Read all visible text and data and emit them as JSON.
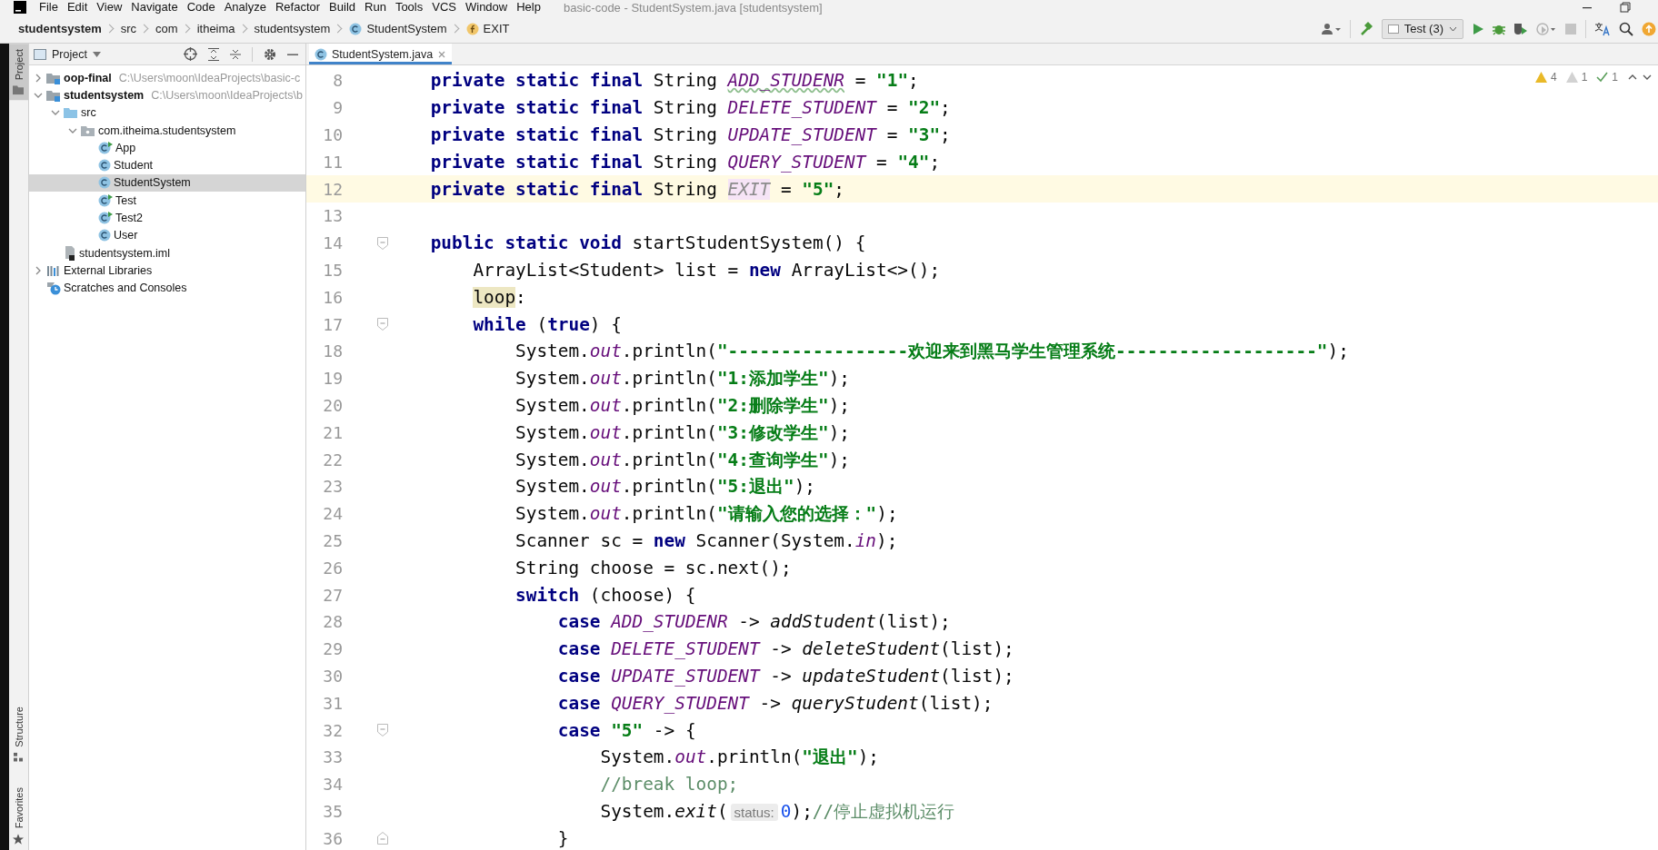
{
  "window": {
    "title": "basic-code - StudentSystem.java [studentsystem]",
    "menu": [
      "File",
      "Edit",
      "View",
      "Navigate",
      "Code",
      "Analyze",
      "Refactor",
      "Build",
      "Run",
      "Tools",
      "VCS",
      "Window",
      "Help"
    ]
  },
  "breadcrumb": [
    {
      "label": "studentsystem",
      "kind": "project"
    },
    {
      "label": "src",
      "kind": "plain"
    },
    {
      "label": "com",
      "kind": "plain"
    },
    {
      "label": "itheima",
      "kind": "plain"
    },
    {
      "label": "studentsystem",
      "kind": "plain"
    },
    {
      "label": "StudentSystem",
      "kind": "class"
    },
    {
      "label": "EXIT",
      "kind": "field"
    }
  ],
  "toolbar": {
    "run_config": "Test (3)"
  },
  "side_tabs": [
    {
      "label": "Project",
      "kind": "project",
      "selected": true
    },
    {
      "label": "Structure",
      "kind": "structure",
      "selected": false
    },
    {
      "label": "Favorites",
      "kind": "favorites",
      "selected": false
    }
  ],
  "project": {
    "title": "Project",
    "tree": [
      {
        "label": "oop-final",
        "kind": "module",
        "path": "C:\\Users\\moon\\IdeaProjects\\basic-c",
        "expanded": false,
        "selected": false
      },
      {
        "label": "studentsystem",
        "kind": "module",
        "path": "C:\\Users\\moon\\IdeaProjects\\b",
        "expanded": true,
        "selected": false,
        "children": [
          {
            "label": "src",
            "kind": "source-folder",
            "expanded": true,
            "selected": false,
            "children": [
              {
                "label": "com.itheima.studentsystem",
                "kind": "package",
                "expanded": true,
                "selected": false,
                "children": [
                  {
                    "label": "App",
                    "kind": "runnable-class",
                    "selected": false
                  },
                  {
                    "label": "Student",
                    "kind": "class",
                    "selected": false
                  },
                  {
                    "label": "StudentSystem",
                    "kind": "class",
                    "selected": true
                  },
                  {
                    "label": "Test",
                    "kind": "runnable-class",
                    "selected": false
                  },
                  {
                    "label": "Test2",
                    "kind": "runnable-class",
                    "selected": false
                  },
                  {
                    "label": "User",
                    "kind": "class",
                    "selected": false
                  }
                ]
              }
            ]
          },
          {
            "label": "studentsystem.iml",
            "kind": "module-file",
            "selected": false
          }
        ]
      },
      {
        "label": "External Libraries",
        "kind": "libraries",
        "expanded": false,
        "selected": false
      },
      {
        "label": "Scratches and Consoles",
        "kind": "scratches",
        "selected": false
      }
    ]
  },
  "editor": {
    "tab": {
      "label": "StudentSystem.java",
      "selected": true
    },
    "inspections": {
      "warnings": "4",
      "weak_warnings": "1",
      "typos": "1"
    },
    "lines": [
      {
        "number": "8",
        "current": false,
        "tokens": [
          {
            "kind": "kw",
            "text": "    private static final"
          },
          {
            "kind": "plain",
            "text": " String "
          },
          {
            "kind": "typo",
            "text": "ADD_STUDENR"
          },
          {
            "kind": "plain",
            "text": " = "
          },
          {
            "kind": "str",
            "text": "\"1\""
          },
          {
            "kind": "plain",
            "text": ";"
          }
        ]
      },
      {
        "number": "9",
        "current": false,
        "tokens": [
          {
            "kind": "kw",
            "text": "    private static final"
          },
          {
            "kind": "plain",
            "text": " String "
          },
          {
            "kind": "const",
            "text": "DELETE_STUDENT"
          },
          {
            "kind": "plain",
            "text": " = "
          },
          {
            "kind": "str",
            "text": "\"2\""
          },
          {
            "kind": "plain",
            "text": ";"
          }
        ]
      },
      {
        "number": "10",
        "current": false,
        "tokens": [
          {
            "kind": "kw",
            "text": "    private static final"
          },
          {
            "kind": "plain",
            "text": " String "
          },
          {
            "kind": "const",
            "text": "UPDATE_STUDENT"
          },
          {
            "kind": "plain",
            "text": " = "
          },
          {
            "kind": "str",
            "text": "\"3\""
          },
          {
            "kind": "plain",
            "text": ";"
          }
        ]
      },
      {
        "number": "11",
        "current": false,
        "tokens": [
          {
            "kind": "kw",
            "text": "    private static final"
          },
          {
            "kind": "plain",
            "text": " String "
          },
          {
            "kind": "const",
            "text": "QUERY_STUDENT"
          },
          {
            "kind": "plain",
            "text": " = "
          },
          {
            "kind": "str",
            "text": "\"4\""
          },
          {
            "kind": "plain",
            "text": ";"
          }
        ]
      },
      {
        "number": "12",
        "current": true,
        "tokens": [
          {
            "kind": "kw",
            "text": "    private static final"
          },
          {
            "kind": "plain",
            "text": " String "
          },
          {
            "kind": "unused",
            "text": "EXIT"
          },
          {
            "kind": "plain",
            "text": " = "
          },
          {
            "kind": "str",
            "text": "\"5\""
          },
          {
            "kind": "plain",
            "text": ";"
          }
        ]
      },
      {
        "number": "13",
        "current": false
      },
      {
        "number": "14",
        "current": false,
        "fold": {
          "kind": "start"
        },
        "tokens": [
          {
            "kind": "kw",
            "text": "    public static void"
          },
          {
            "kind": "plain",
            "text": " startStudentSystem() {"
          }
        ]
      },
      {
        "number": "15",
        "current": false,
        "tokens": [
          {
            "kind": "plain",
            "text": "        ArrayList<Student> list = "
          },
          {
            "kind": "kw",
            "text": "new"
          },
          {
            "kind": "plain",
            "text": " ArrayList<>();"
          }
        ]
      },
      {
        "number": "16",
        "current": false,
        "tokens": [
          {
            "kind": "label",
            "text": "        loop"
          },
          {
            "kind": "plain",
            "text": ":"
          }
        ]
      },
      {
        "number": "17",
        "current": false,
        "fold": {
          "kind": "start"
        },
        "tokens": [
          {
            "kind": "kw",
            "text": "        while"
          },
          {
            "kind": "plain",
            "text": " ("
          },
          {
            "kind": "kw",
            "text": "true"
          },
          {
            "kind": "plain",
            "text": ") {"
          }
        ]
      },
      {
        "number": "18",
        "current": false,
        "tokens": [
          {
            "kind": "plain",
            "text": "            System."
          },
          {
            "kind": "field",
            "text": "out"
          },
          {
            "kind": "plain",
            "text": ".println("
          },
          {
            "kind": "str",
            "text": "\"-----------------欢迎来到黑马学生管理系统-------------------\""
          },
          {
            "kind": "plain",
            "text": ");"
          }
        ]
      },
      {
        "number": "19",
        "current": false,
        "tokens": [
          {
            "kind": "plain",
            "text": "            System."
          },
          {
            "kind": "field",
            "text": "out"
          },
          {
            "kind": "plain",
            "text": ".println("
          },
          {
            "kind": "str",
            "text": "\"1:添加学生\""
          },
          {
            "kind": "plain",
            "text": ");"
          }
        ]
      },
      {
        "number": "20",
        "current": false,
        "tokens": [
          {
            "kind": "plain",
            "text": "            System."
          },
          {
            "kind": "field",
            "text": "out"
          },
          {
            "kind": "plain",
            "text": ".println("
          },
          {
            "kind": "str",
            "text": "\"2:删除学生\""
          },
          {
            "kind": "plain",
            "text": ");"
          }
        ]
      },
      {
        "number": "21",
        "current": false,
        "tokens": [
          {
            "kind": "plain",
            "text": "            System."
          },
          {
            "kind": "field",
            "text": "out"
          },
          {
            "kind": "plain",
            "text": ".println("
          },
          {
            "kind": "str",
            "text": "\"3:修改学生\""
          },
          {
            "kind": "plain",
            "text": ");"
          }
        ]
      },
      {
        "number": "22",
        "current": false,
        "tokens": [
          {
            "kind": "plain",
            "text": "            System."
          },
          {
            "kind": "field",
            "text": "out"
          },
          {
            "kind": "plain",
            "text": ".println("
          },
          {
            "kind": "str",
            "text": "\"4:查询学生\""
          },
          {
            "kind": "plain",
            "text": ");"
          }
        ]
      },
      {
        "number": "23",
        "current": false,
        "tokens": [
          {
            "kind": "plain",
            "text": "            System."
          },
          {
            "kind": "field",
            "text": "out"
          },
          {
            "kind": "plain",
            "text": ".println("
          },
          {
            "kind": "str",
            "text": "\"5:退出\""
          },
          {
            "kind": "plain",
            "text": ");"
          }
        ]
      },
      {
        "number": "24",
        "current": false,
        "tokens": [
          {
            "kind": "plain",
            "text": "            System."
          },
          {
            "kind": "field",
            "text": "out"
          },
          {
            "kind": "plain",
            "text": ".println("
          },
          {
            "kind": "str",
            "text": "\"请输入您的选择：\""
          },
          {
            "kind": "plain",
            "text": ");"
          }
        ]
      },
      {
        "number": "25",
        "current": false,
        "tokens": [
          {
            "kind": "plain",
            "text": "            Scanner sc = "
          },
          {
            "kind": "kw",
            "text": "new"
          },
          {
            "kind": "plain",
            "text": " Scanner(System."
          },
          {
            "kind": "field",
            "text": "in"
          },
          {
            "kind": "plain",
            "text": ");"
          }
        ]
      },
      {
        "number": "26",
        "current": false,
        "tokens": [
          {
            "kind": "plain",
            "text": "            String choose = sc.next();"
          }
        ]
      },
      {
        "number": "27",
        "current": false,
        "tokens": [
          {
            "kind": "kw",
            "text": "            switch"
          },
          {
            "kind": "plain",
            "text": " (choose) {"
          }
        ]
      },
      {
        "number": "28",
        "current": false,
        "tokens": [
          {
            "kind": "kw",
            "text": "                case "
          },
          {
            "kind": "const",
            "text": "ADD_STUDENR"
          },
          {
            "kind": "plain",
            "text": " -> "
          },
          {
            "kind": "call",
            "text": "addStudent"
          },
          {
            "kind": "plain",
            "text": "(list);"
          }
        ]
      },
      {
        "number": "29",
        "current": false,
        "tokens": [
          {
            "kind": "kw",
            "text": "                case "
          },
          {
            "kind": "const",
            "text": "DELETE_STUDENT"
          },
          {
            "kind": "plain",
            "text": " -> "
          },
          {
            "kind": "call",
            "text": "deleteStudent"
          },
          {
            "kind": "plain",
            "text": "(list);"
          }
        ]
      },
      {
        "number": "30",
        "current": false,
        "tokens": [
          {
            "kind": "kw",
            "text": "                case "
          },
          {
            "kind": "const",
            "text": "UPDATE_STUDENT"
          },
          {
            "kind": "plain",
            "text": " -> "
          },
          {
            "kind": "call",
            "text": "updateStudent"
          },
          {
            "kind": "plain",
            "text": "(list);"
          }
        ]
      },
      {
        "number": "31",
        "current": false,
        "tokens": [
          {
            "kind": "kw",
            "text": "                case "
          },
          {
            "kind": "const",
            "text": "QUERY_STUDENT"
          },
          {
            "kind": "plain",
            "text": " -> "
          },
          {
            "kind": "call",
            "text": "queryStudent"
          },
          {
            "kind": "plain",
            "text": "(list);"
          }
        ]
      },
      {
        "number": "32",
        "current": false,
        "fold": {
          "kind": "start"
        },
        "tokens": [
          {
            "kind": "kw",
            "text": "                case "
          },
          {
            "kind": "str",
            "text": "\"5\""
          },
          {
            "kind": "plain",
            "text": " -> {"
          }
        ]
      },
      {
        "number": "33",
        "current": false,
        "tokens": [
          {
            "kind": "plain",
            "text": "                    System."
          },
          {
            "kind": "field",
            "text": "out"
          },
          {
            "kind": "plain",
            "text": ".println("
          },
          {
            "kind": "str",
            "text": "\"退出\""
          },
          {
            "kind": "plain",
            "text": ");"
          }
        ]
      },
      {
        "number": "34",
        "current": false,
        "tokens": [
          {
            "kind": "comment",
            "text": "                    //break loop;"
          }
        ]
      },
      {
        "number": "35",
        "current": false,
        "tokens": [
          {
            "kind": "plain",
            "text": "                    System."
          },
          {
            "kind": "call",
            "text": "exit"
          },
          {
            "kind": "plain",
            "text": "("
          },
          {
            "kind": "hint",
            "text": "status:"
          },
          {
            "kind": "num",
            "text": "0"
          },
          {
            "kind": "plain",
            "text": ");"
          },
          {
            "kind": "comment",
            "text": "//停止虚拟机运行"
          }
        ]
      },
      {
        "number": "36",
        "current": false,
        "fold": {
          "kind": "end"
        },
        "tokens": [
          {
            "kind": "plain",
            "text": "                }"
          }
        ]
      }
    ]
  }
}
